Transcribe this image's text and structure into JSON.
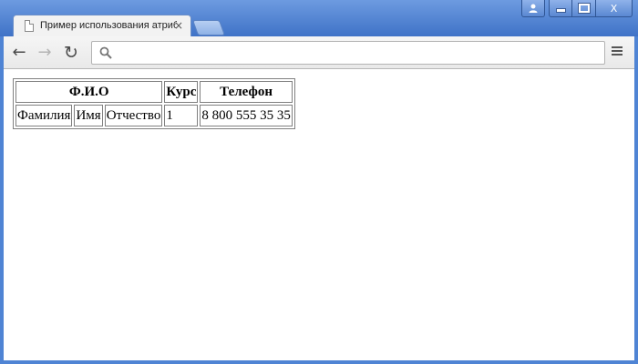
{
  "browser": {
    "tab_title": "Пример использования атрибута",
    "tab_close": "×",
    "address_value": "",
    "controls": {
      "user": "user-icon",
      "minimize": "minimize-icon",
      "maximize": "maximize-icon",
      "close": "X"
    },
    "nav": {
      "back": "←",
      "forward": "→",
      "reload": "↻"
    }
  },
  "table": {
    "headers": {
      "fio": "Ф.И.О",
      "course": "Курс",
      "phone": "Телефон"
    },
    "row": {
      "last_name": "Фамилия",
      "first_name": "Имя",
      "patronymic": "Отчество",
      "course": "1",
      "phone": "8 800 555 35 35"
    }
  }
}
